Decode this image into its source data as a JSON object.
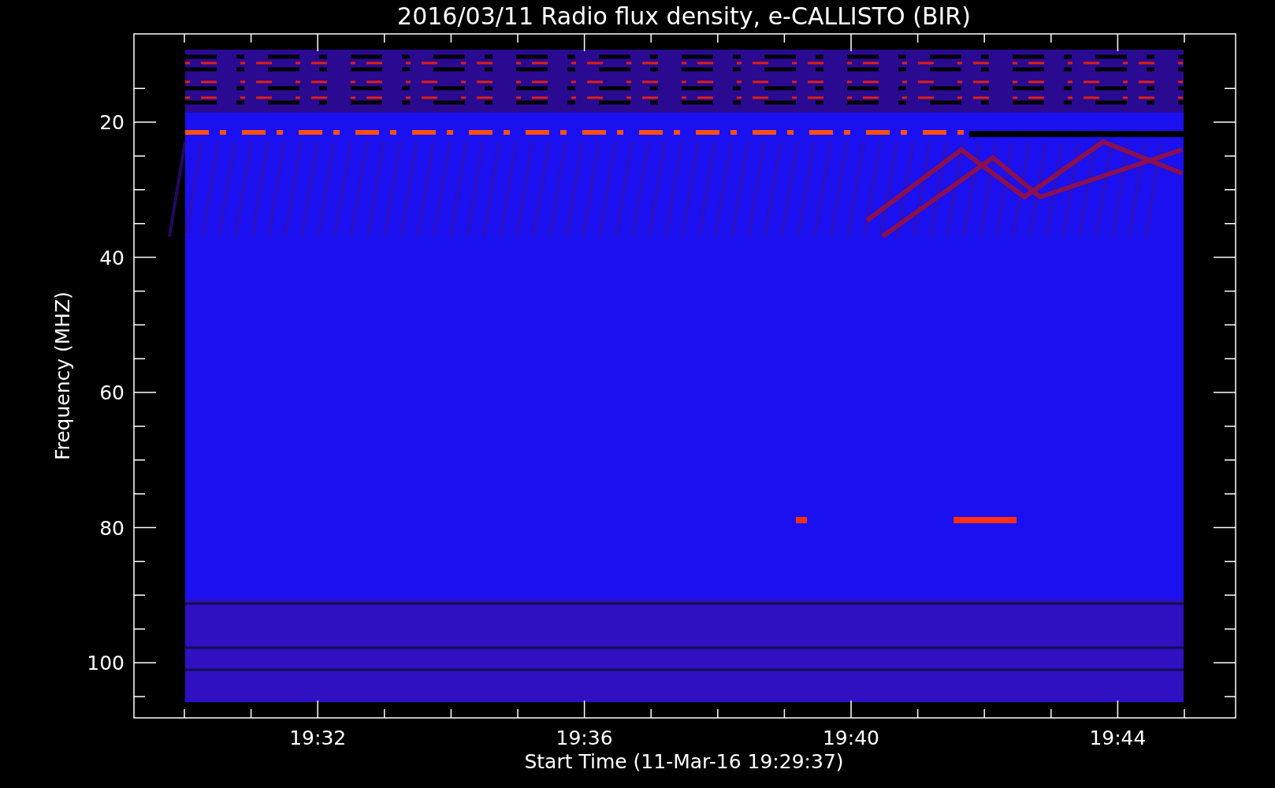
{
  "plot": {
    "title": "2016/03/11  Radio flux density, e-CALLISTO (BIR)",
    "ylabel": "Frequency (MHZ)",
    "xlabel": "Start Time (11-Mar-16 19:29:37)",
    "y_tick_labels": [
      "20",
      "40",
      "60",
      "80",
      "100"
    ],
    "x_tick_labels": [
      "19:32",
      "19:36",
      "19:40",
      "19:44"
    ]
  }
}
